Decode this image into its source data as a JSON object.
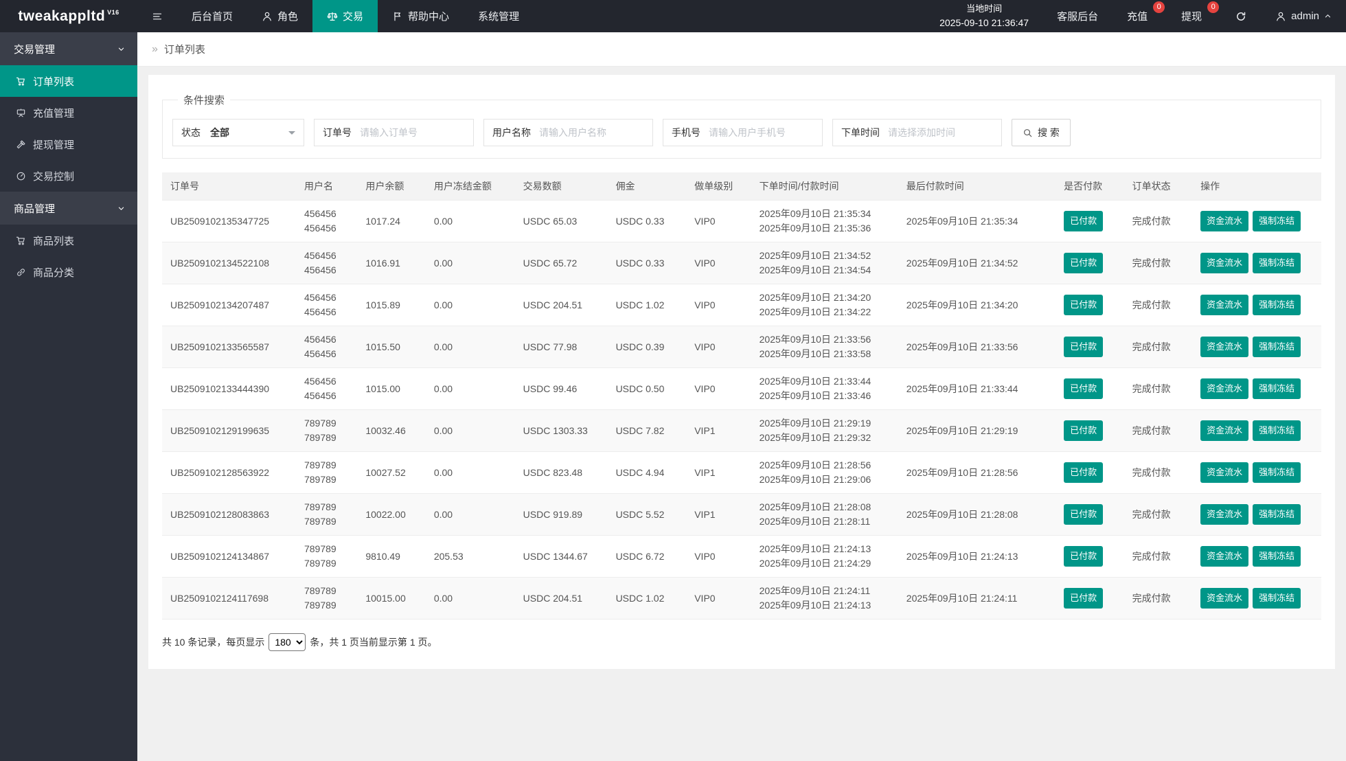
{
  "colors": {
    "accent": "#009688",
    "badge": "#e5433f"
  },
  "topbar": {
    "logo": "tweakappltd",
    "logo_version": "V16",
    "nav": [
      "后台首页",
      "角色",
      "交易",
      "帮助中心",
      "系统管理"
    ],
    "local_time_label": "当地时间",
    "local_time_value": "2025-09-10 21:36:47",
    "customer_service": "客服后台",
    "recharge": "充值",
    "recharge_count": "0",
    "withdraw": "提现",
    "withdraw_count": "0",
    "user": "admin"
  },
  "sidebar": {
    "groups": [
      {
        "label": "交易管理",
        "items": [
          "订单列表",
          "充值管理",
          "提现管理",
          "交易控制"
        ]
      },
      {
        "label": "商品管理",
        "items": [
          "商品列表",
          "商品分类"
        ]
      }
    ],
    "active_item": "订单列表"
  },
  "breadcrumb": {
    "title": "订单列表"
  },
  "search": {
    "legend": "条件搜索",
    "status_label": "状态",
    "status_value": "全部",
    "filters": [
      {
        "label": "订单号",
        "placeholder": "请输入订单号"
      },
      {
        "label": "用户名称",
        "placeholder": "请输入用户名称"
      },
      {
        "label": "手机号",
        "placeholder": "请输入用户手机号"
      },
      {
        "label": "下单时间",
        "placeholder": "请选择添加时间"
      }
    ],
    "button_label": "搜 索"
  },
  "table": {
    "headers": [
      "订单号",
      "用户名",
      "用户余额",
      "用户冻结金额",
      "交易数额",
      "佣金",
      "做单级别",
      "下单时间/付款时间",
      "最后付款时间",
      "是否付款",
      "订单状态",
      "操作"
    ],
    "rows": [
      {
        "order_no": "UB2509102135347725",
        "username": [
          "456456",
          "456456"
        ],
        "balance": "1017.24",
        "frozen": "0.00",
        "amount": "USDC 65.03",
        "commission": "USDC 0.33",
        "level": "VIP0",
        "order_time": "2025年09月10日 21:35:34",
        "pay_time": "2025年09月10日 21:35:36",
        "last_pay_time": "2025年09月10日 21:35:34",
        "paid": "已付款",
        "status": "完成付款",
        "actions": [
          "资金流水",
          "强制冻结"
        ]
      },
      {
        "order_no": "UB2509102134522108",
        "username": [
          "456456",
          "456456"
        ],
        "balance": "1016.91",
        "frozen": "0.00",
        "amount": "USDC 65.72",
        "commission": "USDC 0.33",
        "level": "VIP0",
        "order_time": "2025年09月10日 21:34:52",
        "pay_time": "2025年09月10日 21:34:54",
        "last_pay_time": "2025年09月10日 21:34:52",
        "paid": "已付款",
        "status": "完成付款",
        "actions": [
          "资金流水",
          "强制冻结"
        ]
      },
      {
        "order_no": "UB2509102134207487",
        "username": [
          "456456",
          "456456"
        ],
        "balance": "1015.89",
        "frozen": "0.00",
        "amount": "USDC 204.51",
        "commission": "USDC 1.02",
        "level": "VIP0",
        "order_time": "2025年09月10日 21:34:20",
        "pay_time": "2025年09月10日 21:34:22",
        "last_pay_time": "2025年09月10日 21:34:20",
        "paid": "已付款",
        "status": "完成付款",
        "actions": [
          "资金流水",
          "强制冻结"
        ]
      },
      {
        "order_no": "UB2509102133565587",
        "username": [
          "456456",
          "456456"
        ],
        "balance": "1015.50",
        "frozen": "0.00",
        "amount": "USDC 77.98",
        "commission": "USDC 0.39",
        "level": "VIP0",
        "order_time": "2025年09月10日 21:33:56",
        "pay_time": "2025年09月10日 21:33:58",
        "last_pay_time": "2025年09月10日 21:33:56",
        "paid": "已付款",
        "status": "完成付款",
        "actions": [
          "资金流水",
          "强制冻结"
        ]
      },
      {
        "order_no": "UB2509102133444390",
        "username": [
          "456456",
          "456456"
        ],
        "balance": "1015.00",
        "frozen": "0.00",
        "amount": "USDC 99.46",
        "commission": "USDC 0.50",
        "level": "VIP0",
        "order_time": "2025年09月10日 21:33:44",
        "pay_time": "2025年09月10日 21:33:46",
        "last_pay_time": "2025年09月10日 21:33:44",
        "paid": "已付款",
        "status": "完成付款",
        "actions": [
          "资金流水",
          "强制冻结"
        ]
      },
      {
        "order_no": "UB2509102129199635",
        "username": [
          "789789",
          "789789"
        ],
        "balance": "10032.46",
        "frozen": "0.00",
        "amount": "USDC 1303.33",
        "commission": "USDC 7.82",
        "level": "VIP1",
        "order_time": "2025年09月10日 21:29:19",
        "pay_time": "2025年09月10日 21:29:32",
        "last_pay_time": "2025年09月10日 21:29:19",
        "paid": "已付款",
        "status": "完成付款",
        "actions": [
          "资金流水",
          "强制冻结"
        ]
      },
      {
        "order_no": "UB2509102128563922",
        "username": [
          "789789",
          "789789"
        ],
        "balance": "10027.52",
        "frozen": "0.00",
        "amount": "USDC 823.48",
        "commission": "USDC 4.94",
        "level": "VIP1",
        "order_time": "2025年09月10日 21:28:56",
        "pay_time": "2025年09月10日 21:29:06",
        "last_pay_time": "2025年09月10日 21:28:56",
        "paid": "已付款",
        "status": "完成付款",
        "actions": [
          "资金流水",
          "强制冻结"
        ]
      },
      {
        "order_no": "UB2509102128083863",
        "username": [
          "789789",
          "789789"
        ],
        "balance": "10022.00",
        "frozen": "0.00",
        "amount": "USDC 919.89",
        "commission": "USDC 5.52",
        "level": "VIP1",
        "order_time": "2025年09月10日 21:28:08",
        "pay_time": "2025年09月10日 21:28:11",
        "last_pay_time": "2025年09月10日 21:28:08",
        "paid": "已付款",
        "status": "完成付款",
        "actions": [
          "资金流水",
          "强制冻结"
        ]
      },
      {
        "order_no": "UB2509102124134867",
        "username": [
          "789789",
          "789789"
        ],
        "balance": "9810.49",
        "frozen": "205.53",
        "amount": "USDC 1344.67",
        "commission": "USDC 6.72",
        "level": "VIP0",
        "order_time": "2025年09月10日 21:24:13",
        "pay_time": "2025年09月10日 21:24:29",
        "last_pay_time": "2025年09月10日 21:24:13",
        "paid": "已付款",
        "status": "完成付款",
        "actions": [
          "资金流水",
          "强制冻结"
        ]
      },
      {
        "order_no": "UB2509102124117698",
        "username": [
          "789789",
          "789789"
        ],
        "balance": "10015.00",
        "frozen": "0.00",
        "amount": "USDC 204.51",
        "commission": "USDC 1.02",
        "level": "VIP0",
        "order_time": "2025年09月10日 21:24:11",
        "pay_time": "2025年09月10日 21:24:13",
        "last_pay_time": "2025年09月10日 21:24:11",
        "paid": "已付款",
        "status": "完成付款",
        "actions": [
          "资金流水",
          "强制冻结"
        ]
      }
    ]
  },
  "pagination": {
    "prefix": "共 10 条记录，每页显示",
    "page_size": "180",
    "suffix": "条，共 1 页当前显示第 1 页。"
  }
}
